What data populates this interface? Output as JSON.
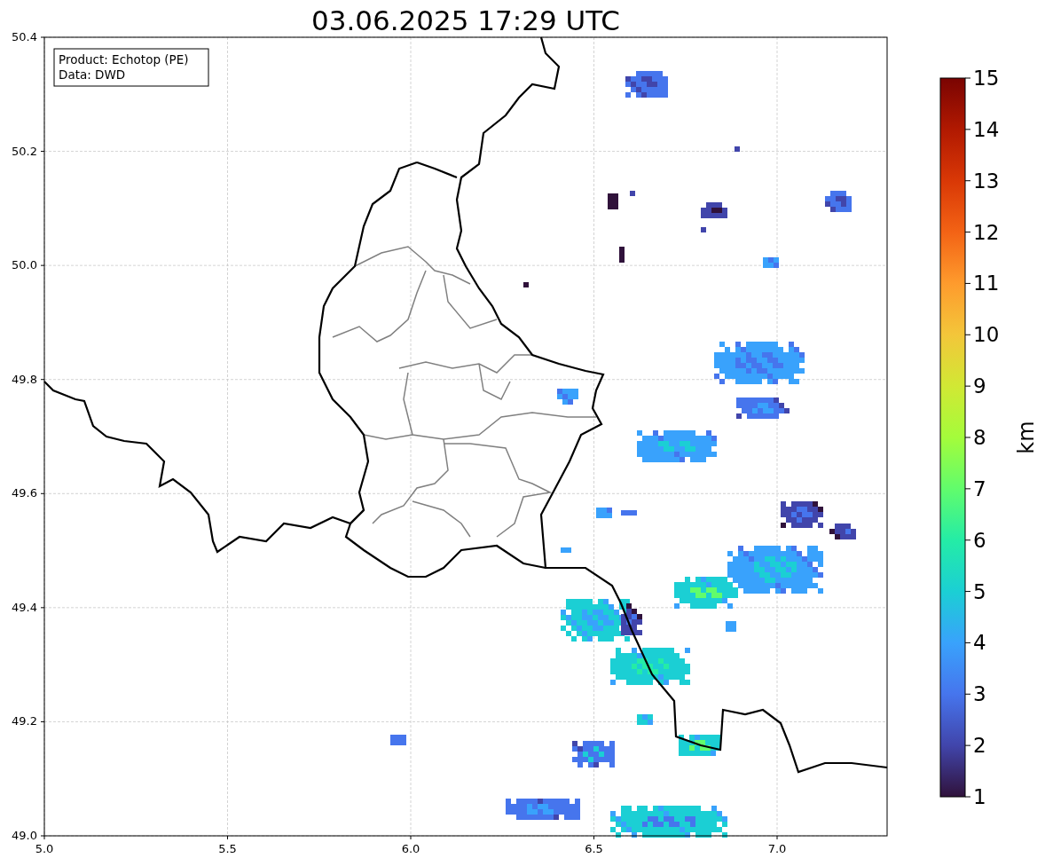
{
  "title": "03.06.2025 17:29 UTC",
  "info_box": {
    "lines": [
      "Product: Echotop (PE)",
      "Data: DWD"
    ]
  },
  "map": {
    "xticks": [
      "5.0",
      "5.5",
      "6.0",
      "6.5",
      "7.0"
    ],
    "yticks": [
      "50.4",
      "50.2",
      "50.0",
      "49.8",
      "49.6",
      "49.4",
      "49.2",
      "49.0"
    ]
  },
  "colorbar": {
    "label": "km",
    "ticks": [
      "15",
      "14",
      "13",
      "12",
      "11",
      "10",
      "9",
      "8",
      "7",
      "6",
      "5",
      "4",
      "3",
      "2",
      "1"
    ]
  }
}
